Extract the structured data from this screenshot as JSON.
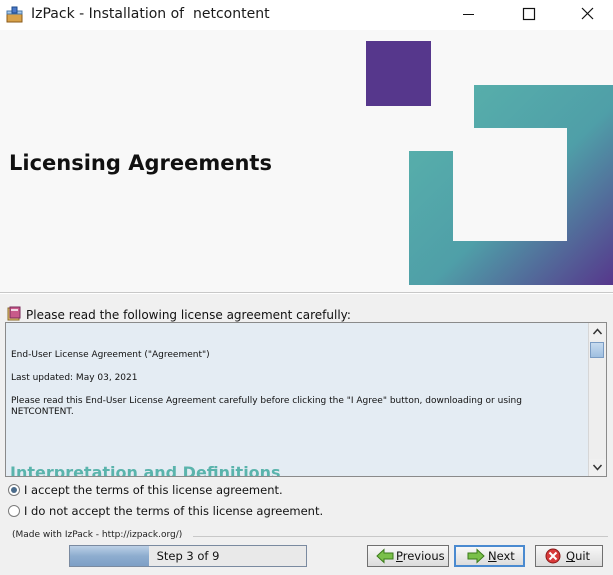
{
  "window": {
    "title": "IzPack - Installation of  netcontent"
  },
  "header": {
    "title": "Licensing Agreements",
    "logo_colors": {
      "purple": "#56378c",
      "teal": "#5ab4ac"
    }
  },
  "license": {
    "prompt": "Please read the following license agreement carefully:",
    "paragraphs": [
      "End-User License Agreement (\"Agreement\")",
      "Last updated: May 03, 2021",
      "Please read this End-User License Agreement carefully before clicking the \"I Agree\" button, downloading or using NETCONTENT."
    ],
    "heading": "Interpretation and Definitions",
    "accept_label": "I accept the terms of this license agreement.",
    "decline_label": "I do not accept the terms of this license agreement.",
    "accept_selected": true
  },
  "footer": {
    "made_with": "(Made with IzPack - http://izpack.org/)",
    "step_label": "Step 3 of 9",
    "step_current": 3,
    "step_total": 9,
    "buttons": {
      "previous_first": "P",
      "previous_rest": "revious",
      "next_first": "N",
      "next_rest": "ext",
      "quit_first": "Q",
      "quit_rest": "uit"
    }
  },
  "icons": {
    "app": "izpack-app-icon",
    "minimize": "minimize-icon",
    "maximize": "maximize-icon",
    "close": "close-icon",
    "prompt": "document-book-icon",
    "previous": "arrow-left-icon",
    "next": "arrow-right-icon",
    "quit": "cancel-icon"
  }
}
